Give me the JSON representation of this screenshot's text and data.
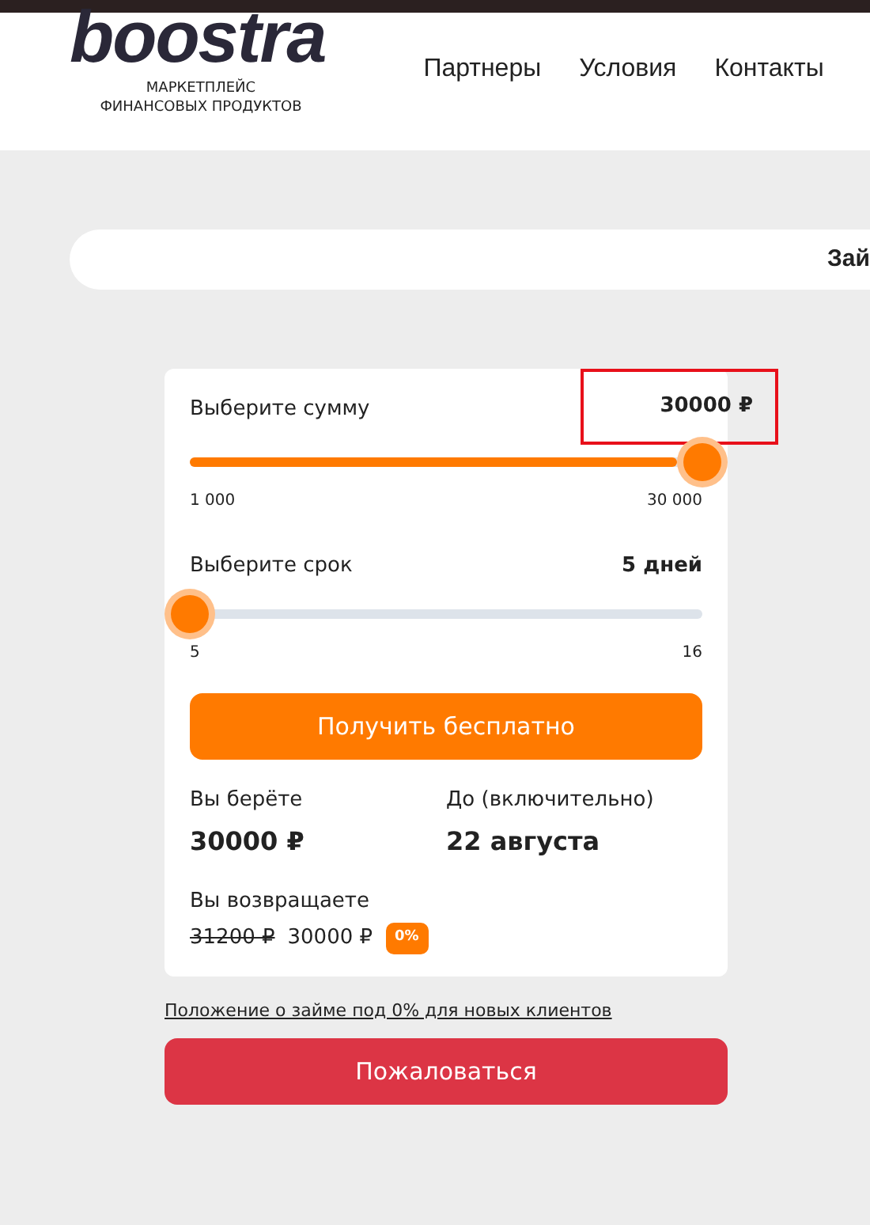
{
  "header": {
    "logo": "boostra",
    "tagline": "МАРКЕТПЛЕЙС ФИНАНСОВЫХ ПРОДУКТОВ",
    "nav": [
      "Партнеры",
      "Условия",
      "Контакты"
    ]
  },
  "banner": {
    "text": "Зай"
  },
  "calculator": {
    "sliders": [
      {
        "label": "Выберите сумму",
        "value": "30000 ₽",
        "highlighted": true,
        "level": 1.0,
        "min": "1 000",
        "max": "30 000"
      },
      {
        "label": "Выберите срок",
        "value": "5 дней",
        "highlighted": false,
        "level": 0.0,
        "min": "5",
        "max": "16"
      }
    ],
    "submit_button": "Получить бесплатно",
    "summary": [
      {
        "label": "Вы берёте",
        "value": "30000 ₽"
      },
      {
        "label": "До (включительно)",
        "value": "22 августа"
      }
    ],
    "return": {
      "label": "Вы возвращаете",
      "old_amount": "31200 ₽",
      "amount": "30000 ₽",
      "badge": "0%"
    }
  },
  "terms_link": "Положение о займе под 0% для новых клиентов",
  "complain_button": "Пожаловаться"
}
